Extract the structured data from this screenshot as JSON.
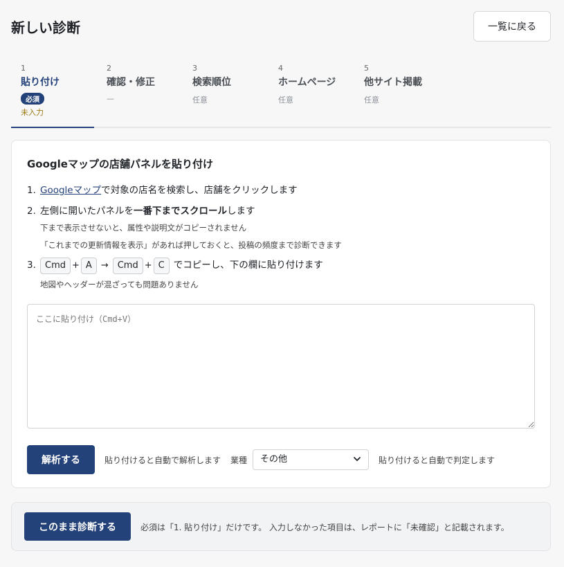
{
  "header": {
    "title": "新しい診断",
    "back_label": "一覧に戻る"
  },
  "steps": [
    {
      "num": "1",
      "title": "貼り付け",
      "badge": "必須",
      "status": "未入力"
    },
    {
      "num": "2",
      "title": "確認・修正",
      "sub": "—"
    },
    {
      "num": "3",
      "title": "検索順位",
      "sub": "任意"
    },
    {
      "num": "4",
      "title": "ホームページ",
      "sub": "任意"
    },
    {
      "num": "5",
      "title": "他サイト掲載",
      "sub": "任意"
    }
  ],
  "card": {
    "title": "Googleマップの店舗パネルを貼り付け",
    "step1": {
      "num": "1.",
      "link": "Googleマップ",
      "text": "で対象の店名を検索し、店舗をクリックします"
    },
    "step2": {
      "num": "2.",
      "pre": "左側に開いたパネルを",
      "bold": "一番下までスクロール",
      "post": "します",
      "note1": "下まで表示させないと、属性や説明文がコピーされません",
      "note2": "「これまでの更新情報を表示」があれば押しておくと、投稿の頻度まで診断できます"
    },
    "step3": {
      "num": "3.",
      "keys": [
        "Cmd",
        "A",
        "Cmd",
        "C"
      ],
      "plus": "+",
      "arrow": "→",
      "text": "でコピーし、下の欄に貼り付けます",
      "note": "地図やヘッダーが混ざっても問題ありません"
    },
    "textarea_placeholder": "ここに貼り付け（Cmd+V）",
    "analyze_label": "解析する",
    "analyze_hint": "貼り付けると自動で解析します",
    "industry_label": "業種",
    "industry_value": "その他",
    "industry_hint": "貼り付けると自動で判定します"
  },
  "footer": {
    "button_label": "このまま診断する",
    "note": "必須は「1. 貼り付け」だけです。 入力しなかった項目は、レポートに「未確認」と記載されます。"
  }
}
